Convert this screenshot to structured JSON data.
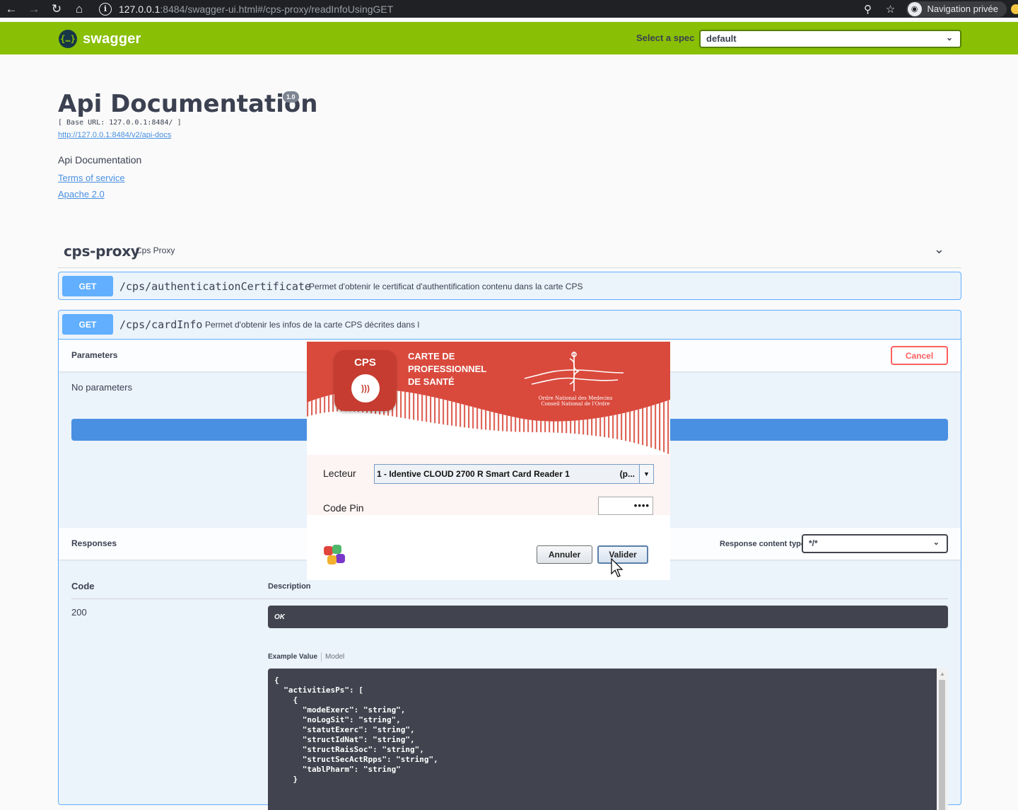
{
  "browser": {
    "url_host": "127.0.0.1",
    "url_rest": ":8484/swagger-ui.html#/cps-proxy/readInfoUsingGET",
    "incognito_label": "Navigation privée",
    "icons": [
      "back-icon",
      "forward-icon",
      "reload-icon",
      "home-icon",
      "info-icon",
      "zoom-icon",
      "star-icon",
      "incognito-icon"
    ]
  },
  "topbar": {
    "logo_mark": "{…}",
    "logo_text": "swagger",
    "spec_label": "Select a spec",
    "spec_value": "default"
  },
  "info": {
    "title": "Api Documentation",
    "version": "1.0",
    "base_url": "[ Base URL: 127.0.0.1:8484/ ]",
    "api_docs_link": "http://127.0.0.1:8484/v2/api-docs",
    "description": "Api Documentation",
    "terms": "Terms of service",
    "license": "Apache 2.0"
  },
  "tag": {
    "name": "cps-proxy",
    "description": "Cps Proxy"
  },
  "operations": [
    {
      "method": "GET",
      "path": "/cps/authenticationCertificate",
      "description": "Permet d'obtenir le certificat d'authentification contenu dans la carte CPS"
    },
    {
      "method": "GET",
      "path": "/cps/cardInfo",
      "description": "Permet d'obtenir les infos de la carte CPS décrites dans l"
    }
  ],
  "op_body": {
    "parameters_title": "Parameters",
    "cancel_label": "Cancel",
    "no_params": "No parameters",
    "responses_title": "Responses",
    "response_content_type_label": "Response content type",
    "response_content_type_value": "*/*",
    "col_code": "Code",
    "col_description": "Description",
    "response_code": "200",
    "response_desc": "OK",
    "tab_example": "Example Value",
    "tab_model": "Model",
    "code_lines": [
      "{",
      "  \"activitiesPs\": [",
      "    {",
      "      \"modeExerc\": \"string\",",
      "      \"noLogSit\": \"string\",",
      "      \"statutExerc\": \"string\",",
      "      \"structIdNat\": \"string\",",
      "      \"structRaisSoc\": \"string\",",
      "      \"structSecActRpps\": \"string\",",
      "      \"tablPharm\": \"string\"",
      "    }"
    ]
  },
  "cps_dialog": {
    "logo_text": "CPS",
    "logo_symbol": ")))",
    "title_lines": [
      "CARTE DE",
      "PROFESSIONNEL",
      "DE SANTÉ"
    ],
    "ordre_line1": "Ordre National des Medecins",
    "ordre_line2": "Conseil National de l'Ordre",
    "lecteur_label": "Lecteur",
    "reader_value": "1 - Identive CLOUD 2700 R Smart Card Reader 1",
    "reader_suffix": "(p...",
    "pin_label": "Code Pin",
    "pin_value": "••••",
    "annuler_label": "Annuler",
    "valider_label": "Valider",
    "colors": {
      "banner_red": "#d94a3d",
      "logo_red": "#c63c30"
    }
  },
  "colors": {
    "swagger_green": "#89bf04",
    "get_blue": "#61affe",
    "execute_blue": "#4990e2",
    "cancel_red": "#ff6060"
  }
}
